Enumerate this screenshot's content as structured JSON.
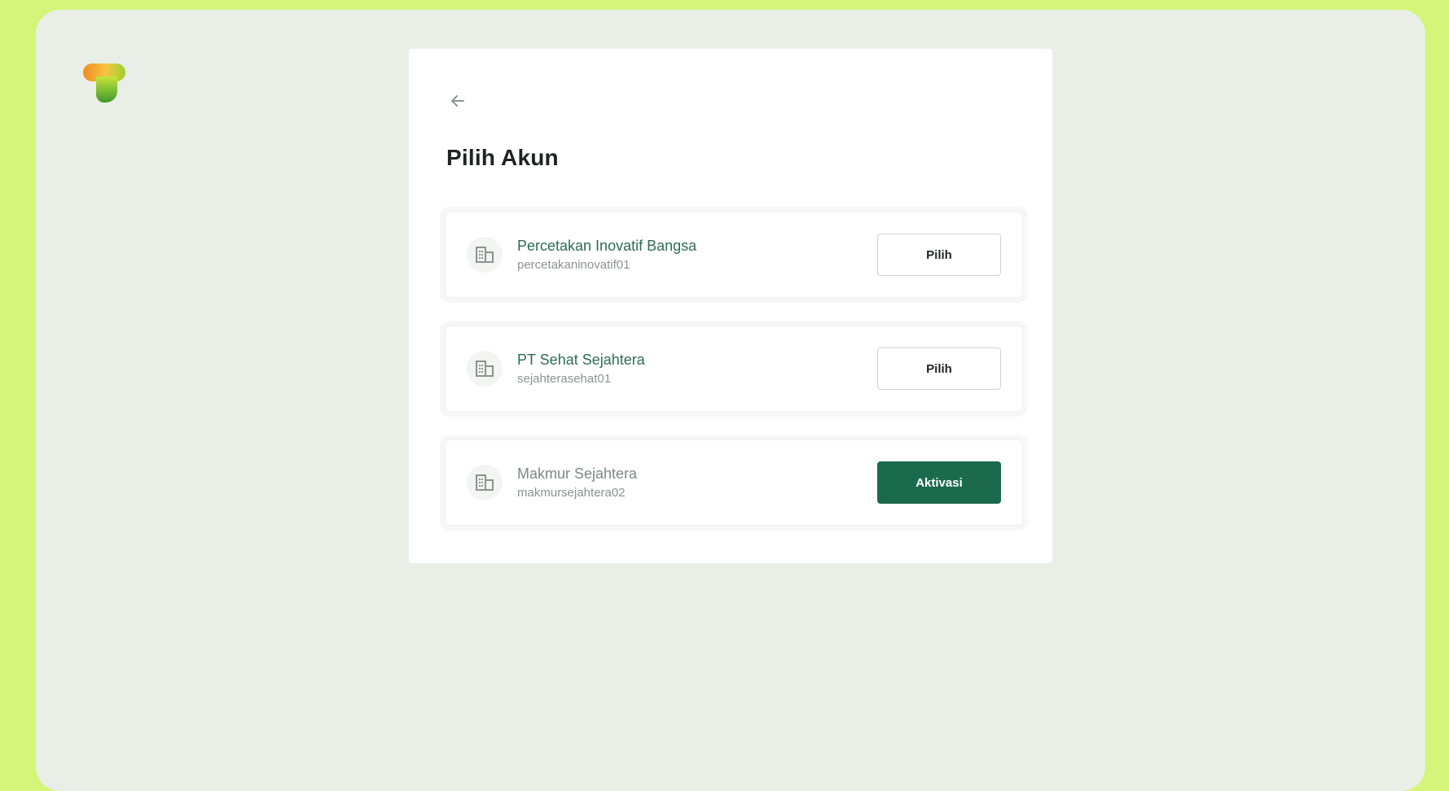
{
  "page": {
    "title": "Pilih Akun",
    "back_label": "Kembali"
  },
  "accounts": [
    {
      "name": "Percetakan Inovatif Bangsa",
      "username": "percetakaninovatif01",
      "action_label": "Pilih",
      "action_type": "select",
      "icon": "building-icon"
    },
    {
      "name": "PT Sehat Sejahtera",
      "username": "sejahterasehat01",
      "action_label": "Pilih",
      "action_type": "select",
      "icon": "building-icon"
    },
    {
      "name": "Makmur Sejahtera",
      "username": "makmursejahtera02",
      "action_label": "Aktivasi",
      "action_type": "activate",
      "icon": "building-icon"
    }
  ],
  "colors": {
    "outer_background": "#d4f57a",
    "frame_background": "#e9efe7",
    "card_background": "#ffffff",
    "accent": "#1c6a4e",
    "account_name": "#2d6b57",
    "title": "#1e2420"
  },
  "logo": {
    "icon": "brand-logo-icon"
  }
}
